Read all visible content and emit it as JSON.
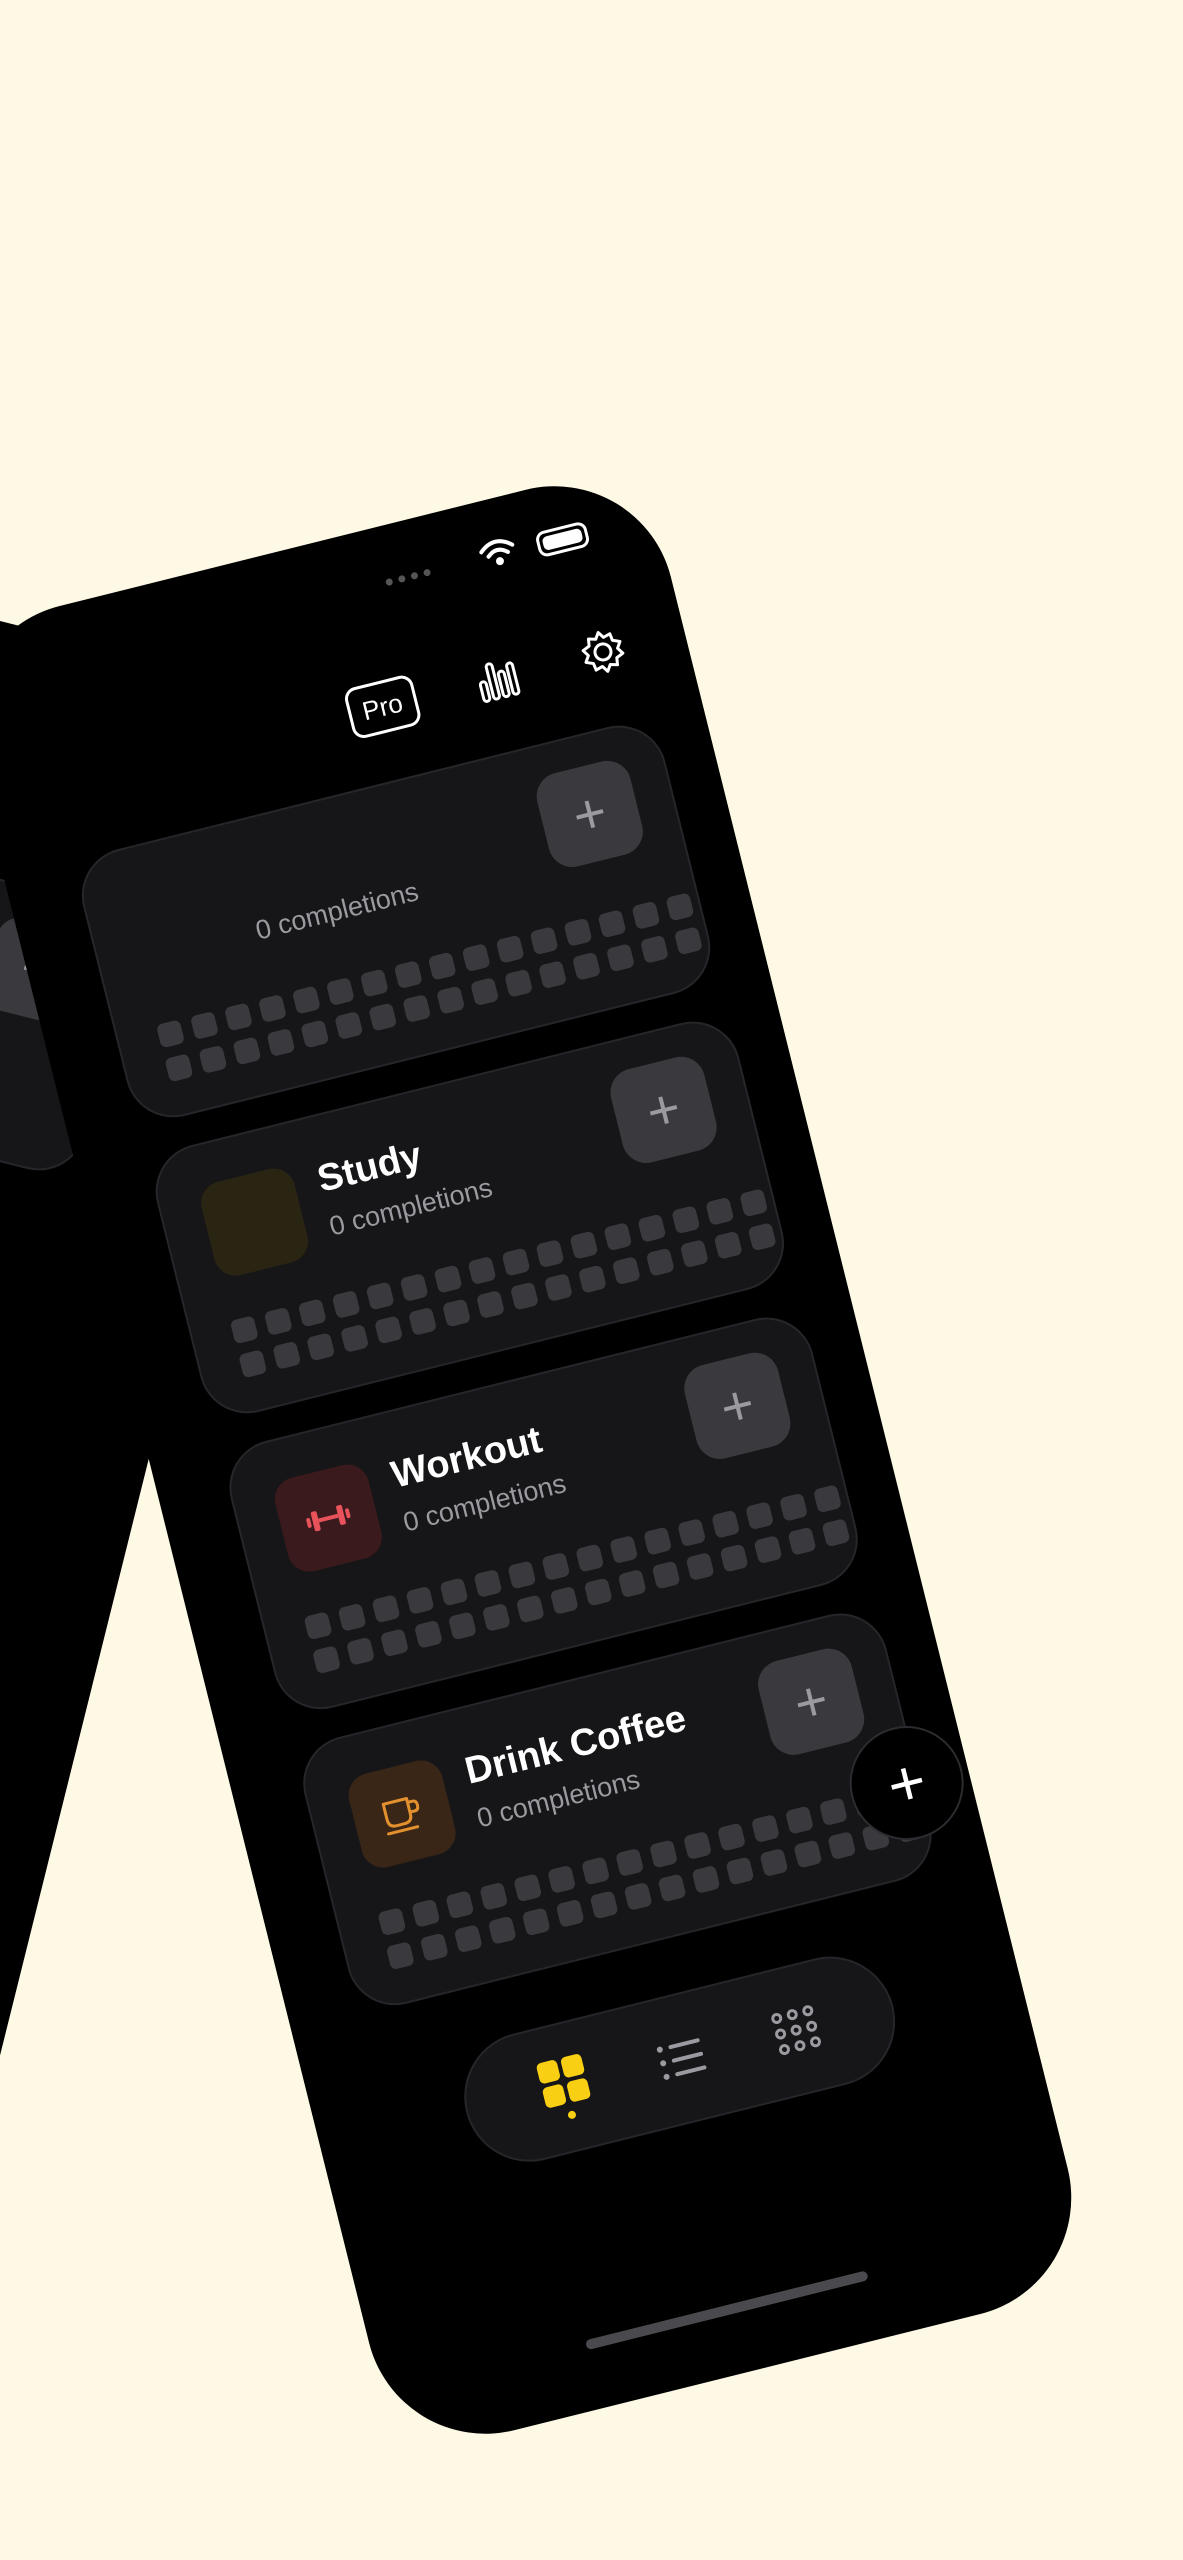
{
  "colors": {
    "background": "#fdf9e5",
    "phone": "#000000",
    "card": "#161618",
    "accent": "#f8cf12",
    "workout_icon": "#e8525a",
    "coffee_icon": "#e3912f"
  },
  "header": {
    "pro_label": "Pro",
    "stats_icon": "bar-chart-icon",
    "settings_icon": "gear-icon"
  },
  "habits": [
    {
      "name": "",
      "subtitle": "0 completions",
      "icon": "",
      "completions": 0
    },
    {
      "name": "Study",
      "subtitle": "0 completions",
      "icon": "",
      "completions": 0
    },
    {
      "name": "Workout",
      "subtitle": "0 completions",
      "icon": "dumbbell-icon",
      "completions": 0
    },
    {
      "name": "Drink Coffee",
      "subtitle": "0 completions",
      "icon": "coffee-cup-icon",
      "completions": 0
    }
  ],
  "fab_label": "+",
  "tabbar": {
    "tabs": [
      {
        "icon": "grid-icon",
        "selected": true
      },
      {
        "icon": "list-icon",
        "selected": false
      },
      {
        "icon": "dots-grid-icon",
        "selected": false
      }
    ]
  }
}
